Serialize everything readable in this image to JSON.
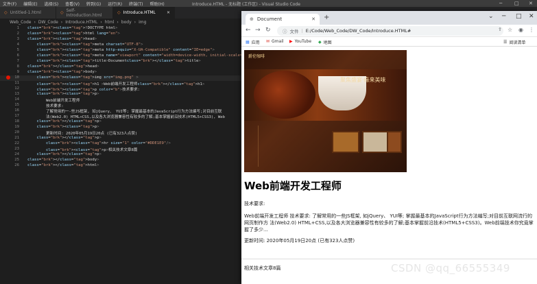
{
  "vscode": {
    "menu": [
      "文件(F)",
      "编辑(E)",
      "选择(S)",
      "查看(V)",
      "转到(G)",
      "运行(R)",
      "终端(T)",
      "帮助(H)"
    ],
    "window_title": "Introduce.HTML - 无标题 (工作区) - Visual Studio Code",
    "tabs": [
      {
        "label": "Untitled-1.html",
        "active": false
      },
      {
        "label": "Self-Introduction.html",
        "active": false
      },
      {
        "label": "Introduce.HTML",
        "active": true
      }
    ],
    "breadcrumb": [
      "Web_Code",
      "DW_Code",
      "Introduce.HTML",
      "html",
      "body",
      "img"
    ],
    "lines": [
      {
        "n": "1",
        "code": "<!DOCTYPE html>"
      },
      {
        "n": "2",
        "code": "<html lang=\"en\">"
      },
      {
        "n": "3",
        "code": "<head>"
      },
      {
        "n": "4",
        "code": "    <meta charset=\"UTF-8\">"
      },
      {
        "n": "5",
        "code": "    <meta http-equiv=\"X-UA-Compatible\" content=\"IE=edge\">"
      },
      {
        "n": "6",
        "code": "    <meta name=\"viewport\" content=\"width=device-width, initial-scale=1.0\">"
      },
      {
        "n": "7",
        "code": "    <title>Document</title>"
      },
      {
        "n": "8",
        "code": "</head>"
      },
      {
        "n": "9",
        "code": "<body>"
      },
      {
        "n": "10",
        "code": "    <img src=\"img.png\" >"
      },
      {
        "n": "11",
        "code": "    <h1 >Web前端开发工程师</h1>"
      },
      {
        "n": "12",
        "code": "    <p color=\"b\">技术要求:"
      },
      {
        "n": "13",
        "code": "    <p>"
      },
      {
        "n": "14",
        "code": "        Web前端开发工程师"
      },
      {
        "n": "15",
        "code": "        技术要求:"
      },
      {
        "n": "16",
        "code": "        了解常用的一-些JS框架, 如jQuery、 YUI等; 掌握最基本的JavaScript行为方法编写;对目前互联"
      },
      {
        "n": "17",
        "code": "        法(Web2.0) HTML+CSS,以及各大浏览器兼容性有较多的了解;基本掌握前沿技术(HTML5+CSS3), Web"
      },
      {
        "n": "18",
        "code": "    </p>"
      },
      {
        "n": "19",
        "code": "    <p>"
      },
      {
        "n": "20",
        "code": "        更新时间: 2020年05月19日20点 (已有323人点赞)"
      },
      {
        "n": "21",
        "code": "    </p>"
      },
      {
        "n": "22",
        "code": "        <hr size=\"1\" color=\"#DDE1E9\"/>"
      },
      {
        "n": "23",
        "code": "        <p>相关技术文章8篇"
      },
      {
        "n": "24",
        "code": "    </p>"
      },
      {
        "n": "25",
        "code": "</body>"
      },
      {
        "n": "26",
        "code": "</html>"
      }
    ],
    "current_line": "10"
  },
  "browser": {
    "tab_title": "Document",
    "address_label": "文件",
    "url": "E:/Code/Web_Code/DW_Code/Introduce.HTML#",
    "bookmarks": [
      "应用",
      "Gmail",
      "YouTube",
      "地图"
    ],
    "reading_list": "阅读清单",
    "hero": {
      "logo_text": "爵伦咖啡",
      "banner_text": "聚焦盛宴·缘来美味"
    },
    "h1": "Web前端开发工程师",
    "p1": "技术要求:",
    "p2": "Web前端开发工程师 技术要求: 了解常用的一些JS框架, 如jQuery、 YUI等; 掌握最基本的JavaScript行为方法编写;对目前互联网流行的网页制作方 法(Web2.0) HTML+CSS,以及各大浏览器兼容性有较多的了解;基本掌握前沿技术(HTML5+CSS3)。Web前端技术你究竟掌握了多少...",
    "p3": "更新时间: 2020年05月19日20点 (已有323人点赞)",
    "p4": "相关技术文章8篇"
  },
  "watermark": "CSDN @qq_66555349"
}
